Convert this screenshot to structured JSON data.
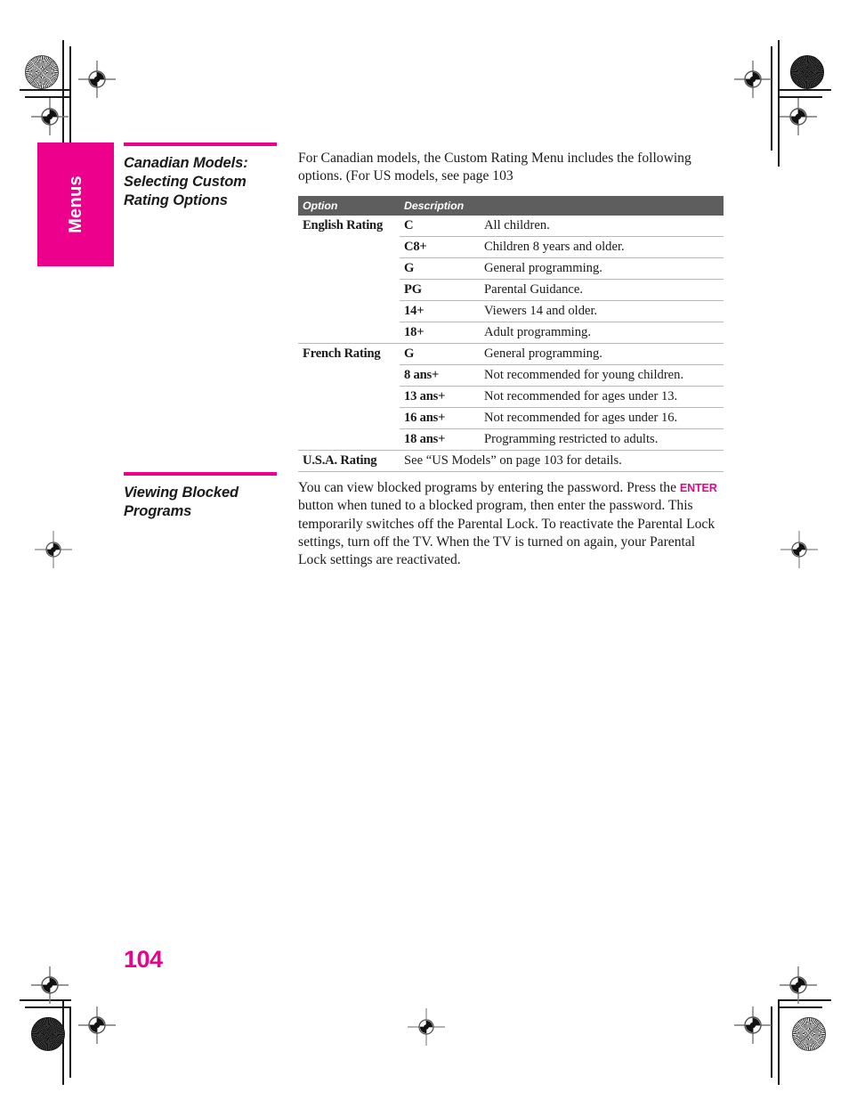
{
  "page": {
    "number": "104",
    "side_tab_label": "Menus",
    "accent_color": "#ec008c",
    "table_header_color": "#5e5e5e"
  },
  "sections": [
    {
      "heading": "Canadian Models: Selecting Custom Rating Options",
      "intro": "For Canadian models, the Custom Rating Menu includes the following options. (For US models, see page 103",
      "table": {
        "headers": [
          "Option",
          "Description"
        ],
        "groups": [
          {
            "category": "English Rating",
            "rows": [
              {
                "option": "C",
                "description": "All children."
              },
              {
                "option": "C8+",
                "description": "Children 8 years and older."
              },
              {
                "option": "G",
                "description": "General programming."
              },
              {
                "option": "PG",
                "description": "Parental Guidance."
              },
              {
                "option": "14+",
                "description": "Viewers 14 and older."
              },
              {
                "option": "18+",
                "description": "Adult programming."
              }
            ]
          },
          {
            "category": "French Rating",
            "rows": [
              {
                "option": "G",
                "description": "General programming."
              },
              {
                "option": "8 ans+",
                "description": "Not recommended for young children."
              },
              {
                "option": "13 ans+",
                "description": "Not recommended for ages under 13."
              },
              {
                "option": "16 ans+",
                "description": "Not recommended for ages under 16."
              },
              {
                "option": "18 ans+",
                "description": "Programming restricted to adults."
              }
            ]
          },
          {
            "category": "U.S.A. Rating",
            "full_row": "See “US Models” on page 103 for details.",
            "rows": []
          }
        ]
      }
    },
    {
      "heading": "Viewing Blocked Programs",
      "body_before_kbd": "You can view blocked programs by entering the password. Press the ",
      "kbd": "ENTER",
      "body_after_kbd": " button when tuned to a blocked program, then enter the password. This temporarily switches off the Parental Lock. To reactivate the Parental Lock settings, turn off the TV. When the TV is turned on again, your Parental Lock settings are reactivated."
    }
  ]
}
